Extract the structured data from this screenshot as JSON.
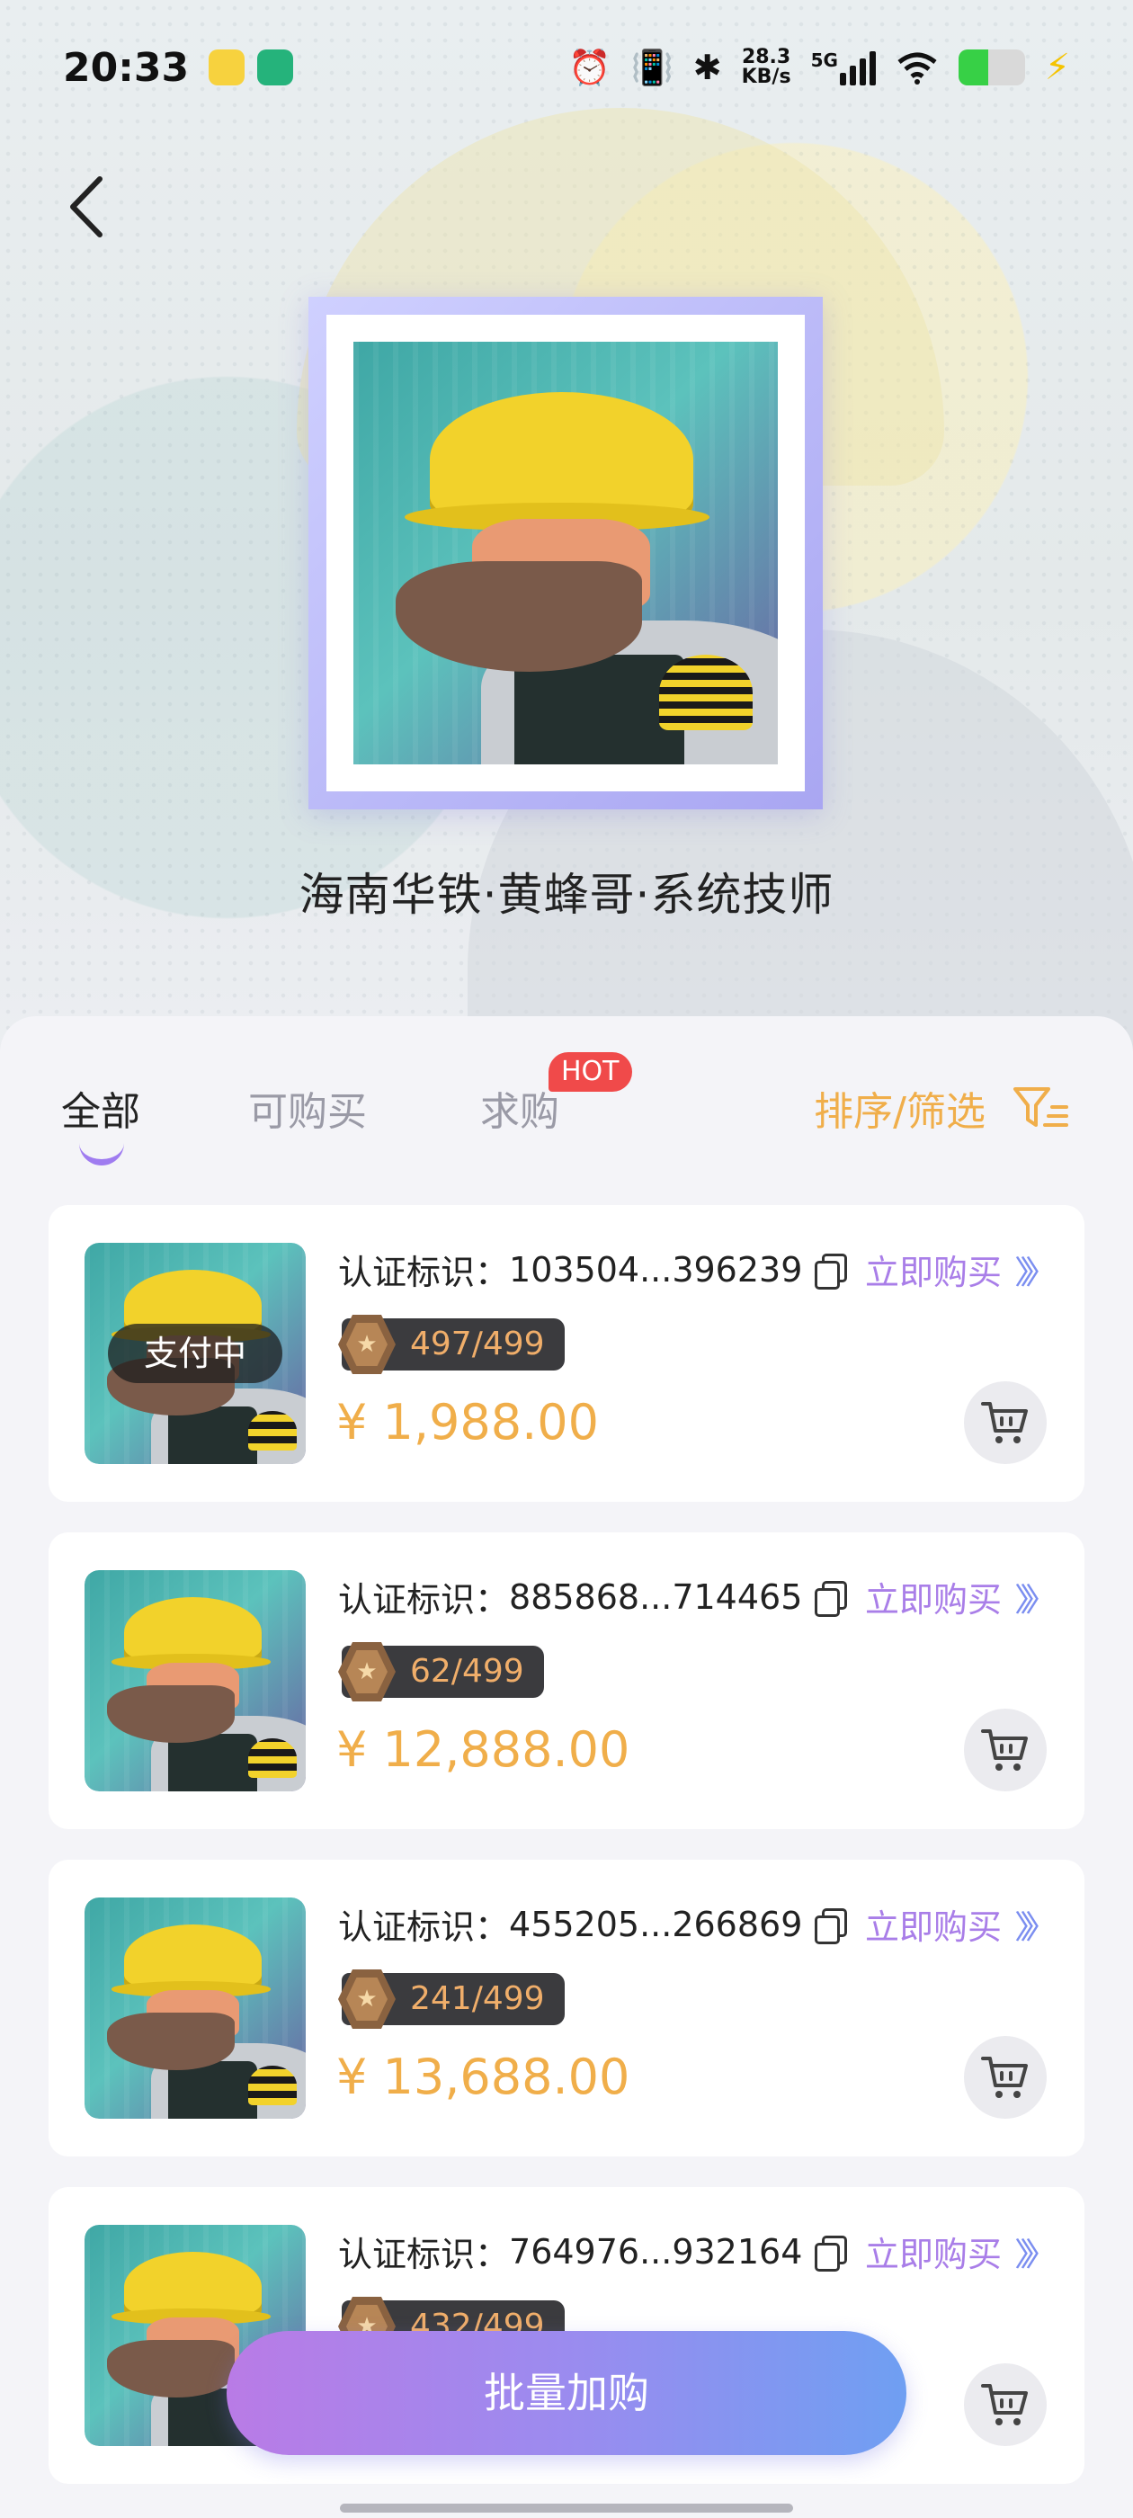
{
  "status_bar": {
    "time": "20:33",
    "net_speed_value": "28.3",
    "net_speed_unit": "KB/s",
    "network": "5G",
    "battery_level": 0.45
  },
  "product": {
    "title": "海南华铁·黄蜂哥·系统技师"
  },
  "tabs": {
    "all": "全部",
    "buyable": "可购买",
    "want": "求购",
    "hot_badge": "HOT",
    "sort_filter": "排序/筛选"
  },
  "listings": [
    {
      "cert_label": "认证标识：",
      "cert_id": "103504...396239",
      "buy_now": "立即购买",
      "edition": "497/499",
      "price": "¥ 1,988.00",
      "status": "支付中"
    },
    {
      "cert_label": "认证标识：",
      "cert_id": "885868...714465",
      "buy_now": "立即购买",
      "edition": "62/499",
      "price": "¥ 12,888.00"
    },
    {
      "cert_label": "认证标识：",
      "cert_id": "455205...266869",
      "buy_now": "立即购买",
      "edition": "241/499",
      "price": "¥ 13,688.00"
    },
    {
      "cert_label": "认证标识：",
      "cert_id": "764976...932164",
      "buy_now": "立即购买",
      "edition": "432/499"
    }
  ],
  "bulk_button": "批量加购",
  "colors": {
    "accent_orange": "#f0ae4a",
    "accent_purple": "#a97ee8",
    "hot_red": "#f04a4a"
  }
}
